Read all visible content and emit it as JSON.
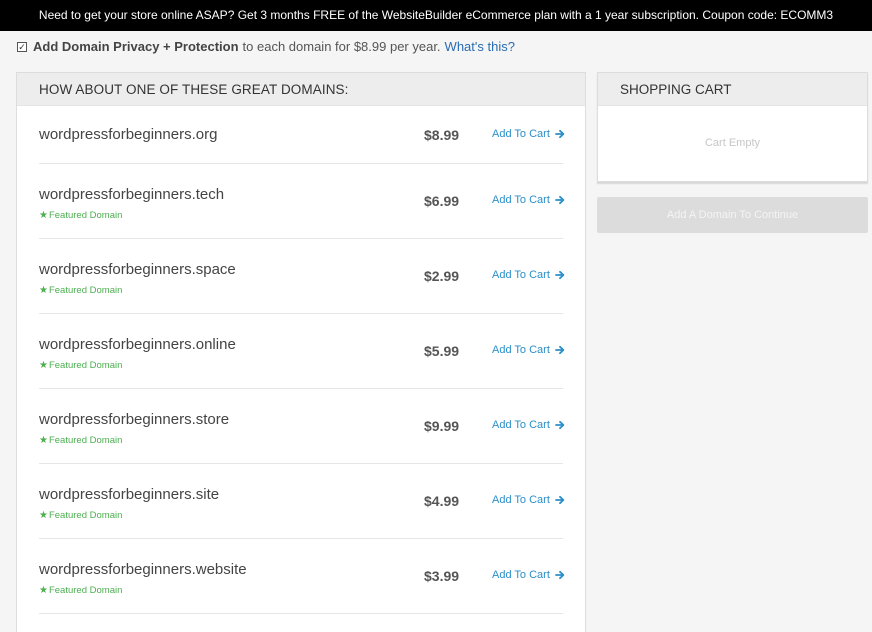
{
  "promo": {
    "text": "Need to get your store online ASAP? Get 3 months FREE of the WebsiteBuilder eCommerce plan with a 1 year subscription. Coupon code: ECOMM3"
  },
  "privacy": {
    "strong_label": "Add Domain Privacy + Protection",
    "text": "to each domain for $8.99 per year.",
    "link": "What's this?"
  },
  "suggestions": {
    "title": "HOW ABOUT ONE OF THESE GREAT DOMAINS:",
    "add_label": "Add To Cart",
    "featured_label": "Featured Domain",
    "domains": [
      {
        "name": "wordpressforbeginners.org",
        "price": "$8.99",
        "featured": false
      },
      {
        "name": "wordpressforbeginners.tech",
        "price": "$6.99",
        "featured": true
      },
      {
        "name": "wordpressforbeginners.space",
        "price": "$2.99",
        "featured": true
      },
      {
        "name": "wordpressforbeginners.online",
        "price": "$5.99",
        "featured": true
      },
      {
        "name": "wordpressforbeginners.store",
        "price": "$9.99",
        "featured": true
      },
      {
        "name": "wordpressforbeginners.site",
        "price": "$4.99",
        "featured": true
      },
      {
        "name": "wordpressforbeginners.website",
        "price": "$3.99",
        "featured": true
      }
    ]
  },
  "cart": {
    "title": "SHOPPING CART",
    "empty_text": "Cart Empty",
    "continue_label": "Add A Domain To Continue"
  },
  "colors": {
    "link_blue": "#2b8fc9",
    "featured_green": "#4caf50",
    "promo_bg": "#000000"
  }
}
